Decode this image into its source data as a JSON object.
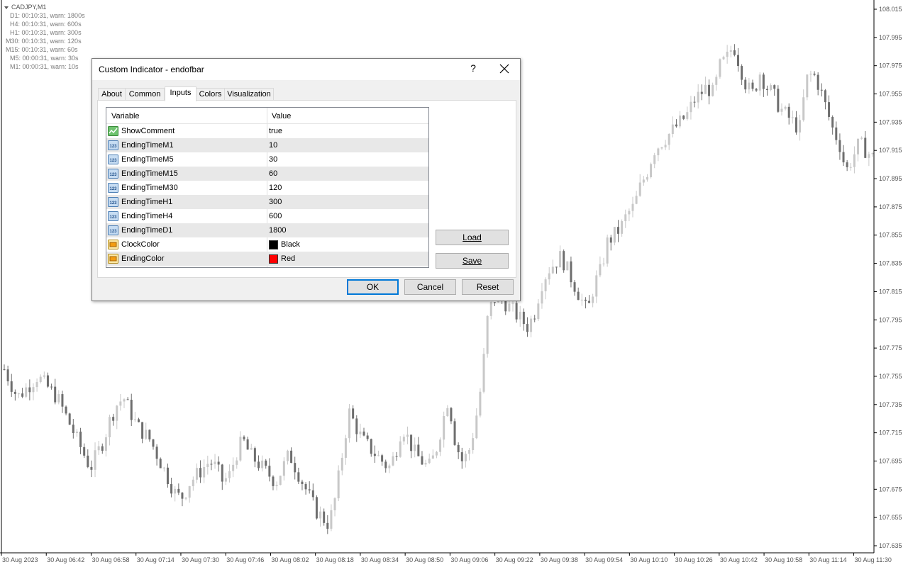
{
  "chart": {
    "symbol": "CADJPY,M1",
    "comment_lines": [
      "D1: 00:10:31, warn: 1800s",
      "H4: 00:10:31, warn: 600s",
      "H1: 00:10:31, warn: 300s",
      "M30: 00:10:31, warn: 120s",
      "M15: 00:10:31, warn: 60s",
      "M5: 00:00:31, warn: 30s",
      "M1: 00:00:31, warn: 10s"
    ],
    "price_labels": [
      "108.015",
      "107.995",
      "107.975",
      "107.955",
      "107.935",
      "107.915",
      "107.895",
      "107.875",
      "107.855",
      "107.835",
      "107.815",
      "107.795",
      "107.775",
      "107.755",
      "107.735",
      "107.715",
      "107.695",
      "107.675",
      "107.655",
      "107.635"
    ],
    "time_labels": [
      "30 Aug 2023",
      "30 Aug 06:42",
      "30 Aug 06:58",
      "30 Aug 07:14",
      "30 Aug 07:30",
      "30 Aug 07:46",
      "30 Aug 08:02",
      "30 Aug 08:18",
      "30 Aug 08:34",
      "30 Aug 08:50",
      "30 Aug 09:06",
      "30 Aug 09:22",
      "30 Aug 09:38",
      "30 Aug 09:54",
      "30 Aug 10:10",
      "30 Aug 10:26",
      "30 Aug 10:42",
      "30 Aug 10:58",
      "30 Aug 11:14",
      "30 Aug 11:30"
    ],
    "close_path": [
      107.76,
      107.75,
      107.74,
      107.745,
      107.75,
      107.755,
      107.75,
      107.745,
      107.74,
      107.73,
      107.72,
      107.71,
      107.7,
      107.69,
      107.7,
      107.71,
      107.725,
      107.735,
      107.74,
      107.73,
      107.72,
      107.715,
      107.71,
      107.7,
      107.69,
      107.68,
      107.67,
      107.67,
      107.68,
      107.685,
      107.69,
      107.695,
      107.69,
      107.68,
      107.685,
      107.7,
      107.71,
      107.7,
      107.695,
      107.69,
      107.685,
      107.68,
      107.69,
      107.7,
      107.69,
      107.68,
      107.67,
      107.66,
      107.655,
      107.65,
      107.67,
      107.7,
      107.73,
      107.72,
      107.71,
      107.705,
      107.7,
      107.695,
      107.69,
      107.7,
      107.72,
      107.71,
      107.7,
      107.695,
      107.69,
      107.7,
      107.72,
      107.74,
      107.71,
      107.695,
      107.7,
      107.72,
      107.75,
      107.8,
      107.81,
      107.81,
      107.805,
      107.8,
      107.795,
      107.79,
      107.8,
      107.82,
      107.83,
      107.835,
      107.84,
      107.83,
      107.82,
      107.81,
      107.8,
      107.82,
      107.83,
      107.85,
      107.855,
      107.86,
      107.87,
      107.875,
      107.89,
      107.9,
      107.915,
      107.92,
      107.925,
      107.93,
      107.935,
      107.94,
      107.95,
      107.955,
      107.96,
      107.955,
      107.975,
      107.98,
      107.99,
      107.975,
      107.96,
      107.955,
      107.97,
      107.96,
      107.955,
      107.945,
      107.94,
      107.935,
      107.93,
      107.965,
      107.97,
      107.96,
      107.945,
      107.93,
      107.92,
      107.9,
      107.91,
      107.92,
      107.915,
      107.91
    ],
    "colors": {
      "axis_text": "#555555",
      "candle_up": "#c8c8c8",
      "candle_down": "#6e6e6e",
      "grid_line": "#000000"
    }
  },
  "dialog": {
    "title": "Custom Indicator - endofbar",
    "help_label": "?",
    "tabs": [
      "About",
      "Common",
      "Inputs",
      "Colors",
      "Visualization"
    ],
    "active_tab": "Inputs",
    "grid": {
      "col_variable": "Variable",
      "col_value": "Value",
      "rows": [
        {
          "icon": "bool-icon",
          "variable": "ShowComment",
          "value": "true"
        },
        {
          "icon": "number-icon",
          "variable": "EndingTimeM1",
          "value": "10"
        },
        {
          "icon": "number-icon",
          "variable": "EndingTimeM5",
          "value": "30"
        },
        {
          "icon": "number-icon",
          "variable": "EndingTimeM15",
          "value": "60"
        },
        {
          "icon": "number-icon",
          "variable": "EndingTimeM30",
          "value": "120"
        },
        {
          "icon": "number-icon",
          "variable": "EndingTimeH1",
          "value": "300"
        },
        {
          "icon": "number-icon",
          "variable": "EndingTimeH4",
          "value": "600"
        },
        {
          "icon": "number-icon",
          "variable": "EndingTimeD1",
          "value": "1800"
        },
        {
          "icon": "color-icon",
          "variable": "ClockColor",
          "value": "Black",
          "swatch": "#000000"
        },
        {
          "icon": "color-icon",
          "variable": "EndingColor",
          "value": "Red",
          "swatch": "#ff0000"
        }
      ]
    },
    "buttons": {
      "load": "Load",
      "save": "Save",
      "ok": "OK",
      "cancel": "Cancel",
      "reset": "Reset"
    }
  }
}
